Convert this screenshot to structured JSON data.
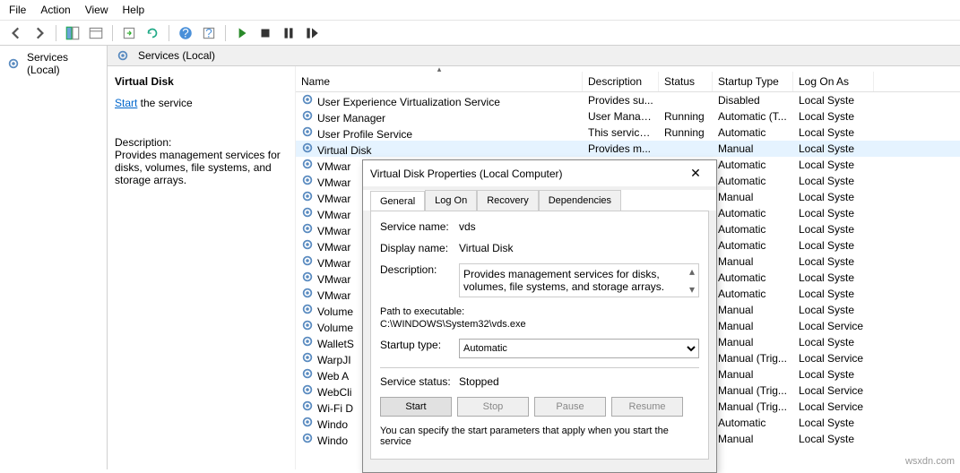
{
  "menu": {
    "file": "File",
    "action": "Action",
    "view": "View",
    "help": "Help"
  },
  "nav": {
    "root": "Services (Local)"
  },
  "header": {
    "title": "Services (Local)"
  },
  "detail": {
    "title": "Virtual Disk",
    "start_link": "Start",
    "start_suffix": " the service",
    "desc_label": "Description:",
    "desc": "Provides management services for disks, volumes, file systems, and storage arrays."
  },
  "columns": {
    "name": "Name",
    "desc": "Description",
    "status": "Status",
    "startup": "Startup Type",
    "logon": "Log On As"
  },
  "rows": [
    {
      "name": "User Experience Virtualization Service",
      "desc": "Provides su...",
      "status": "",
      "startup": "Disabled",
      "logon": "Local Syste"
    },
    {
      "name": "User Manager",
      "desc": "User Manag...",
      "status": "Running",
      "startup": "Automatic (T...",
      "logon": "Local Syste"
    },
    {
      "name": "User Profile Service",
      "desc": "This service ...",
      "status": "Running",
      "startup": "Automatic",
      "logon": "Local Syste"
    },
    {
      "name": "Virtual Disk",
      "desc": "Provides m...",
      "status": "",
      "startup": "Manual",
      "logon": "Local Syste",
      "selected": true
    },
    {
      "name": "VMwar",
      "desc": "",
      "status": "",
      "startup": "Automatic",
      "logon": "Local Syste"
    },
    {
      "name": "VMwar",
      "desc": "",
      "status": "",
      "startup": "Automatic",
      "logon": "Local Syste"
    },
    {
      "name": "VMwar",
      "desc": "",
      "status": "",
      "startup": "Manual",
      "logon": "Local Syste"
    },
    {
      "name": "VMwar",
      "desc": "",
      "status": "",
      "startup": "Automatic",
      "logon": "Local Syste"
    },
    {
      "name": "VMwar",
      "desc": "",
      "status": "",
      "startup": "Automatic",
      "logon": "Local Syste"
    },
    {
      "name": "VMwar",
      "desc": "",
      "status": "",
      "startup": "Automatic",
      "logon": "Local Syste"
    },
    {
      "name": "VMwar",
      "desc": "",
      "status": "",
      "startup": "Manual",
      "logon": "Local Syste"
    },
    {
      "name": "VMwar",
      "desc": "",
      "status": "",
      "startup": "Automatic",
      "logon": "Local Syste"
    },
    {
      "name": "VMwar",
      "desc": "",
      "status": "",
      "startup": "Automatic",
      "logon": "Local Syste"
    },
    {
      "name": "Volume",
      "desc": "",
      "status": "",
      "startup": "Manual",
      "logon": "Local Syste"
    },
    {
      "name": "Volume",
      "desc": "",
      "status": "",
      "startup": "Manual",
      "logon": "Local Service"
    },
    {
      "name": "WalletS",
      "desc": "",
      "status": "",
      "startup": "Manual",
      "logon": "Local Syste"
    },
    {
      "name": "WarpJI",
      "desc": "",
      "status": "",
      "startup": "Manual (Trig...",
      "logon": "Local Service"
    },
    {
      "name": "Web A",
      "desc": "",
      "status": "",
      "startup": "Manual",
      "logon": "Local Syste"
    },
    {
      "name": "WebCli",
      "desc": "",
      "status": "",
      "startup": "Manual (Trig...",
      "logon": "Local Service"
    },
    {
      "name": "Wi-Fi D",
      "desc": "",
      "status": "",
      "startup": "Manual (Trig...",
      "logon": "Local Service"
    },
    {
      "name": "Windo",
      "desc": "",
      "status": "",
      "startup": "Automatic",
      "logon": "Local Syste"
    },
    {
      "name": "Windo",
      "desc": "",
      "status": "",
      "startup": "Manual",
      "logon": "Local Syste"
    }
  ],
  "dialog": {
    "title": "Virtual Disk Properties (Local Computer)",
    "tabs": {
      "general": "General",
      "logon": "Log On",
      "recovery": "Recovery",
      "deps": "Dependencies"
    },
    "svc_name_l": "Service name:",
    "svc_name": "vds",
    "disp_name_l": "Display name:",
    "disp_name": "Virtual Disk",
    "desc_l": "Description:",
    "desc": "Provides management services for disks, volumes, file systems, and storage arrays.",
    "path_l": "Path to executable:",
    "path": "C:\\WINDOWS\\System32\\vds.exe",
    "startup_l": "Startup type:",
    "startup": "Automatic",
    "status_l": "Service status:",
    "status": "Stopped",
    "btn_start": "Start",
    "btn_stop": "Stop",
    "btn_pause": "Pause",
    "btn_resume": "Resume",
    "hint": "You can specify the start parameters that apply when you start the service"
  },
  "watermark": "wsxdn.com"
}
